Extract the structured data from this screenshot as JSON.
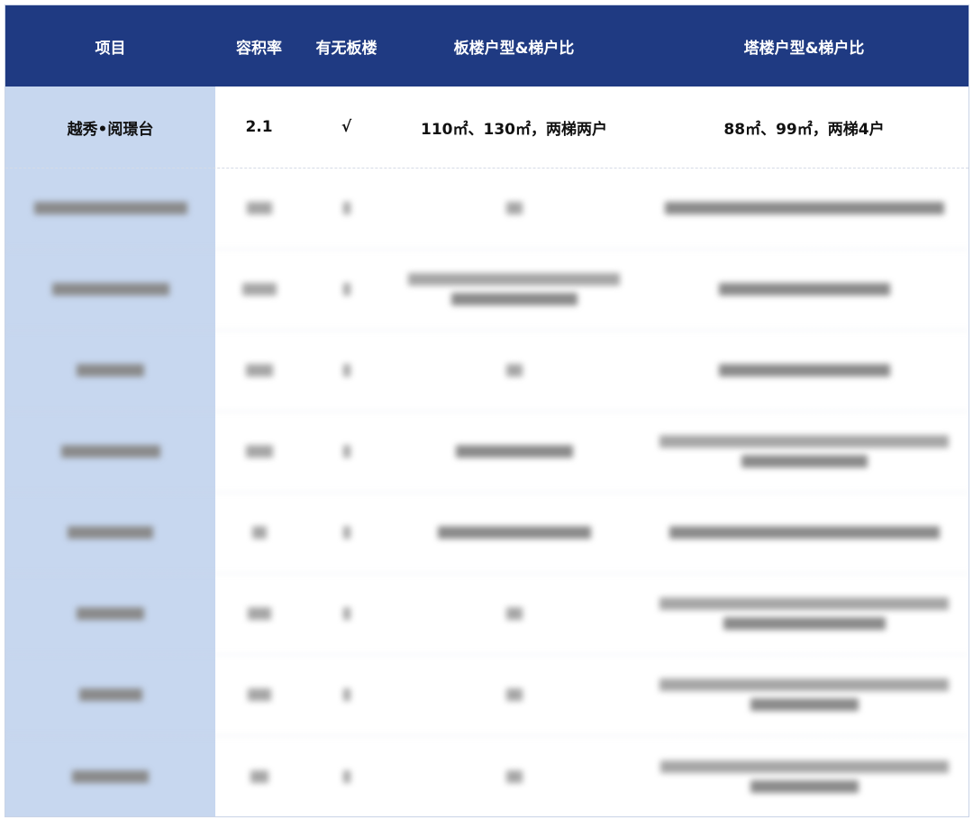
{
  "header": {
    "project": "项目",
    "far": "容积率",
    "has_slab": "有无板楼",
    "slab_units": "板楼户型&梯户比",
    "tower_units": "塔楼户型&梯户比"
  },
  "rows": [
    {
      "project": "越秀•阅璟台",
      "far": "2.1",
      "has_slab": "√",
      "slab_units": "110㎡、130㎡，两梯两户",
      "tower_units": "88㎡、99㎡，两梯4户"
    }
  ],
  "colors": {
    "header_bg": "#1f3a82",
    "first_col_bg": "#c7d7ef"
  }
}
